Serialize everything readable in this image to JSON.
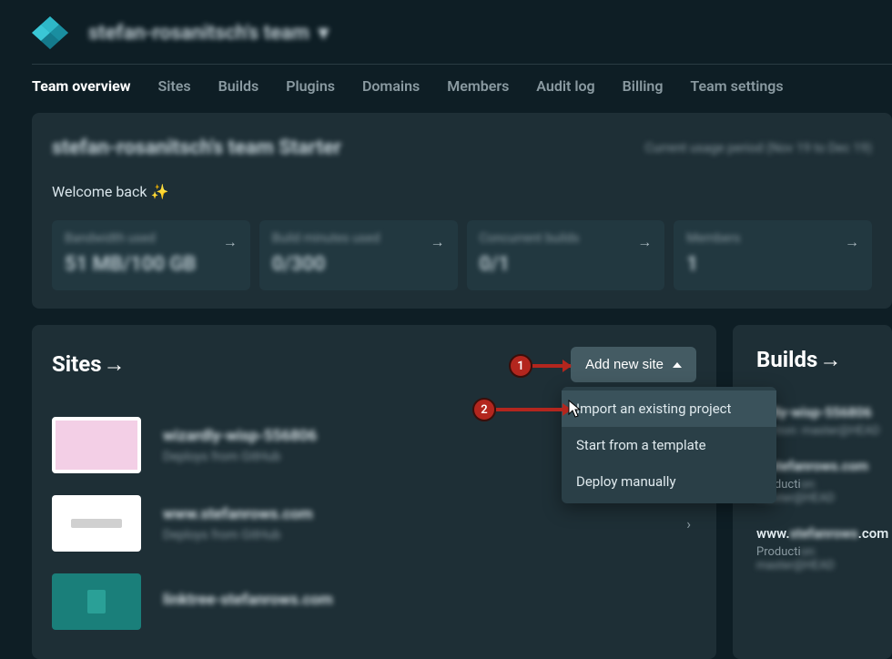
{
  "header": {
    "team_name": "stefan-rosanitsch's team"
  },
  "nav": {
    "overview": "Team overview",
    "sites": "Sites",
    "builds": "Builds",
    "plugins": "Plugins",
    "domains": "Domains",
    "members": "Members",
    "audit": "Audit log",
    "billing": "Billing",
    "settings": "Team settings"
  },
  "overview": {
    "title": "stefan-rosanitsch's team",
    "badge": "Starter",
    "usage_note": "Current usage period (Nov 19 to Dec 19)",
    "welcome": "Welcome back ✨",
    "stats": [
      {
        "label": "Bandwidth used",
        "value": "51 MB/100 GB"
      },
      {
        "label": "Build minutes used",
        "value": "0/300"
      },
      {
        "label": "Concurrent builds",
        "value": "0/1"
      },
      {
        "label": "Members",
        "value": "1"
      }
    ]
  },
  "sites": {
    "title": "Sites",
    "add_label": "Add new site",
    "dropdown": {
      "import": "Import an existing project",
      "template": "Start from a template",
      "manual": "Deploy manually"
    },
    "items": [
      {
        "name": "wizardly-wisp-556806",
        "sub": "Deploys from GitHub"
      },
      {
        "name": "www.stefanrows.com",
        "sub": "Deploys from GitHub"
      },
      {
        "name": "linktree-stefanrows.com",
        "sub": ""
      }
    ]
  },
  "builds": {
    "title": "Builds",
    "items": [
      {
        "name": "ardly-wisp-556806",
        "sub": "duction: master@HEAD"
      },
      {
        "name": "w.stefanrows.com",
        "sub_prefix": "Producti",
        "sub_blur": "on: master@HEAD"
      },
      {
        "name": "www.stefanrows.com",
        "sub_prefix": "Producti",
        "sub_blur": "on: master@HEAD"
      }
    ]
  },
  "annotations": {
    "one": "1",
    "two": "2"
  }
}
